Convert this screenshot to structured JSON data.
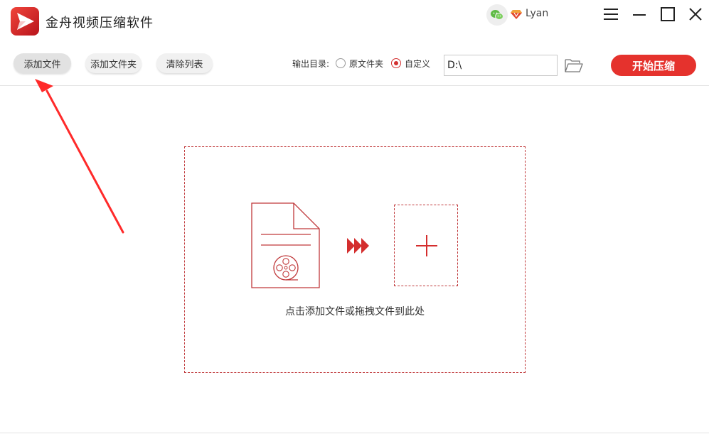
{
  "app": {
    "title": "金舟视频压缩软件"
  },
  "user": {
    "name": "Lyan"
  },
  "toolbar": {
    "add_file": "添加文件",
    "add_folder": "添加文件夹",
    "clear_list": "清除列表",
    "output_label": "输出目录:",
    "option_original": "原文件夹",
    "option_custom": "自定义",
    "selected_option": "自定义",
    "path_value": "D:\\",
    "start_button": "开始压缩"
  },
  "drop_zone": {
    "hint": "点击添加文件或拖拽文件到此处"
  },
  "colors": {
    "accent": "#e5322d",
    "dashed_border": "#c0393b",
    "annotation_arrow": "#ff2a2a"
  },
  "icons": [
    "app-logo-icon",
    "wechat-icon",
    "vip-diamond-icon",
    "menu-icon",
    "minimize-icon",
    "maximize-icon",
    "close-icon",
    "folder-open-icon",
    "video-file-icon",
    "forward-arrows-icon",
    "plus-icon"
  ]
}
